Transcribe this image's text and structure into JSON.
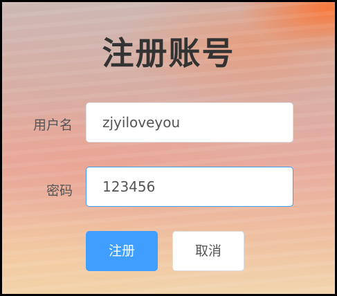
{
  "form": {
    "title": "注册账号",
    "username": {
      "label": "用户名",
      "value": "zjyiloveyou"
    },
    "password": {
      "label": "密码",
      "value": "123456"
    },
    "submit_label": "注册",
    "cancel_label": "取消"
  },
  "colors": {
    "primary": "#409eff",
    "title": "#333333",
    "border": "#dcdfe6"
  }
}
